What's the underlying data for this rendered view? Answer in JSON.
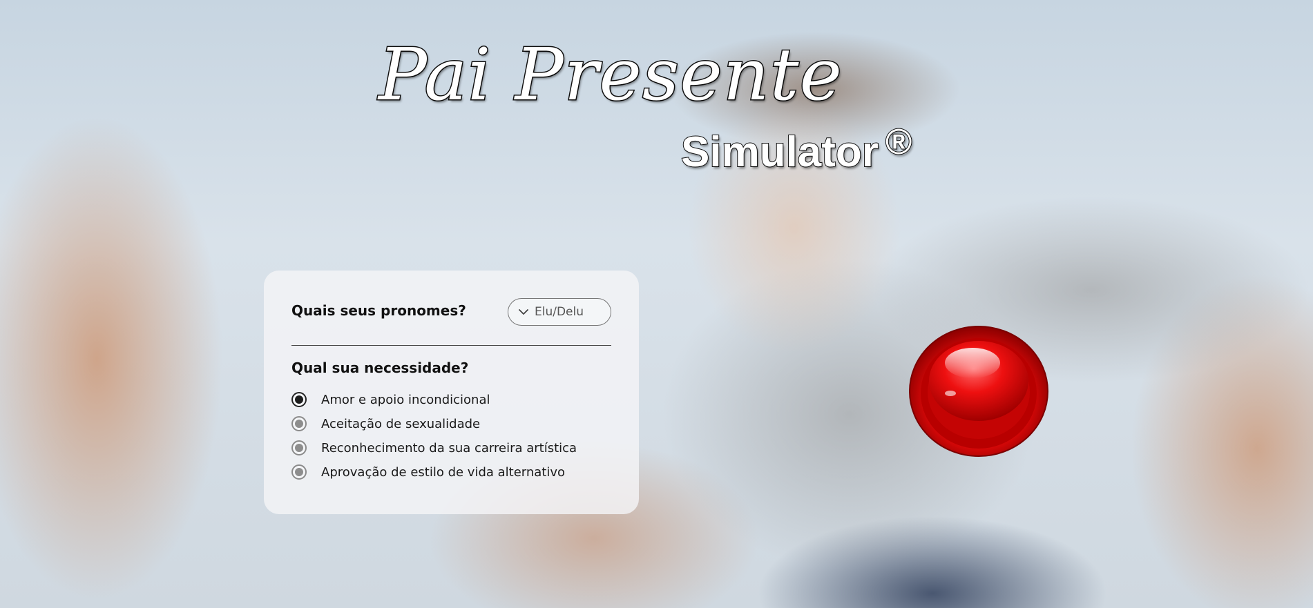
{
  "logo": {
    "title": "Pai Presente",
    "subtitle": "Simulator",
    "registered": "®"
  },
  "form": {
    "pronoun_question": "Quais seus pronomes?",
    "pronoun_selected": "Elu/Delu",
    "need_question": "Qual sua necessidade?",
    "options": [
      {
        "label": "Amor e apoio incondicional",
        "checked": true
      },
      {
        "label": "Aceitação de sexualidade",
        "checked": false
      },
      {
        "label": "Reconhecimento da sua carreira artística",
        "checked": false
      },
      {
        "label": "Aprovação de estilo de vida alternativo",
        "checked": false
      }
    ]
  },
  "colors": {
    "button_red": "#e01010",
    "panel_bg": "#f4f4f6"
  },
  "icons": {
    "dropdown": "chevron-down-icon",
    "action": "red-push-button-icon"
  }
}
